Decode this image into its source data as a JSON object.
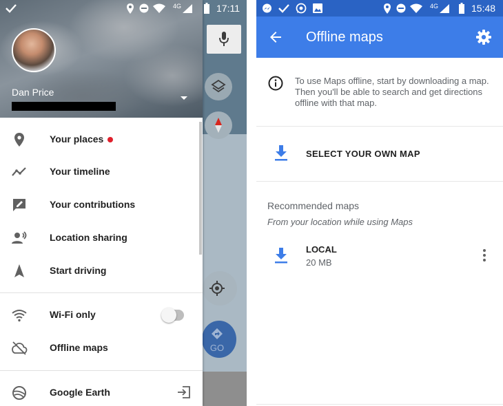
{
  "left_screen": {
    "status_bar": {
      "time": "17:11",
      "network": "4G"
    },
    "account": {
      "name": "Dan Price"
    },
    "menu": {
      "your_places": "Your places",
      "your_timeline": "Your timeline",
      "your_contributions": "Your contributions",
      "location_sharing": "Location sharing",
      "start_driving": "Start driving",
      "wifi_only": "Wi-Fi only",
      "offline_maps": "Offline maps",
      "google_earth": "Google Earth"
    },
    "wifi_only_enabled": false,
    "map": {
      "go_label": "GO"
    },
    "colors": {
      "notification_dot": "#e0202c",
      "go_button": "#3a67a8"
    }
  },
  "right_screen": {
    "status_bar": {
      "time": "15:48",
      "network": "4G"
    },
    "app_bar": {
      "title": "Offline maps"
    },
    "info_text": "To use Maps offline, start by downloading a map. Then you'll be able to search and get directions offline with that map.",
    "select_own_map": "SELECT YOUR OWN MAP",
    "recommended": {
      "title": "Recommended maps",
      "subtitle": "From your location while using Maps",
      "items": [
        {
          "name": "LOCAL",
          "size": "20 MB"
        }
      ]
    },
    "colors": {
      "app_bar": "#3d7de8",
      "status_bar": "#2a63c4",
      "accent": "#3d7de8"
    },
    "icons": [
      "back-arrow-icon",
      "settings-gear-icon",
      "info-icon",
      "download-icon",
      "more-vert-icon"
    ]
  }
}
